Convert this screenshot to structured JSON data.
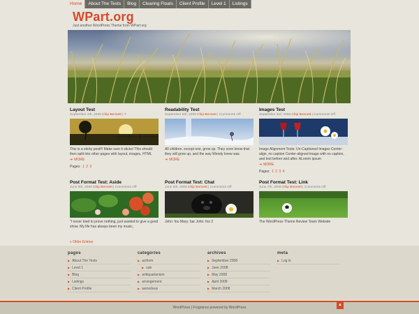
{
  "nav": {
    "items": [
      {
        "label": "Home",
        "active": true
      },
      {
        "label": "About The Tests",
        "active": false
      },
      {
        "label": "Blog",
        "active": false
      },
      {
        "label": "Clearing Floats",
        "active": false
      },
      {
        "label": "Client Profile",
        "active": false
      },
      {
        "label": "Level 1",
        "active": false
      },
      {
        "label": "Listings",
        "active": false
      }
    ]
  },
  "site": {
    "title": "WPart.org",
    "tagline": "Just another WordPress Theme from WPart.org"
  },
  "posts": [
    {
      "title": "Layout Test",
      "date": "September 4th, 2008",
      "author": "Chip Bennett",
      "comments": "7",
      "excerpt": "This is a sticky postl!! Make sure it sticks! This should then split into other pages with layout, images, HTML",
      "more": "MORE",
      "pages_label": "Pages:",
      "pages": [
        "1",
        "2",
        "3"
      ],
      "thumb": "sunset-tree"
    },
    {
      "title": "Readability Test",
      "date": "September 5th, 2008",
      "author": "Chip Bennett",
      "comments": "Comments Off",
      "excerpt": "All children, except one, grow up. They soon know that they will grow up, and the way Wendy knew was",
      "more": "MORE",
      "thumb": "snow-landscape"
    },
    {
      "title": "Images Test",
      "date": "September 3rd, 2008",
      "author": "Chip Bennett",
      "comments": "Comments Off",
      "excerpt": "Image Alignment Tests: Un-Captioned Images Center-align, no caption Center-aligned image with no caption, and text before and after. ALorem ipsum",
      "more": "MORE",
      "pages_label": "Pages:",
      "pages": [
        "1",
        "2",
        "3",
        "4"
      ],
      "thumb": "wine-glasses"
    },
    {
      "title": "Post Format Test: Aside",
      "date": "June 5th, 2008",
      "author": "Chip Bennett",
      "comments": "Comments Off",
      "excerpt": "\"I never tried to prove nothing, just wanted to give a good show. My life has always been my music,",
      "thumb": "flowers"
    },
    {
      "title": "Post Format Test: Chat",
      "date": "June 5th, 2008",
      "author": "Chip Bennett",
      "comments": "Comments Off",
      "excerpt": "John: foo Mary: bar John: foo 2",
      "thumb": "dog-daisy"
    },
    {
      "title": "Post Format Test: Link",
      "date": "June 7th, 2008",
      "author": "Chip Bennett",
      "comments": "Comments Off",
      "excerpt": "The WordPress Theme Review Team Website",
      "thumb": "soccer-ball"
    }
  ],
  "older_link": "« Older Entries",
  "widgets": {
    "pages": {
      "title": "pages",
      "items": [
        "About The Tests",
        "Level 1",
        "Blog",
        "Listings",
        "Client Profile"
      ]
    },
    "categories": {
      "title": "categories",
      "items": [
        {
          "label": "aciform",
          "sub": false
        },
        {
          "label": "sub",
          "sub": true
        },
        {
          "label": "antiquarianism",
          "sub": false
        },
        {
          "label": "arrangement",
          "sub": false
        },
        {
          "label": "asmodeus",
          "sub": false
        }
      ]
    },
    "archives": {
      "title": "archives",
      "items": [
        "September 2008",
        "June 2008",
        "May 2008",
        "April 2008",
        "March 2008"
      ]
    },
    "meta": {
      "title": "meta",
      "items": [
        "Log in"
      ]
    }
  },
  "footer": {
    "credit": "WordPress | Fragrance powered by WordPress",
    "to_top_icon": "up-arrow-icon",
    "to_top_glyph": "▲"
  },
  "colors": {
    "accent": "#d54a2a",
    "background": "#e7e5dc",
    "nav_bg": "#6a6a62"
  }
}
